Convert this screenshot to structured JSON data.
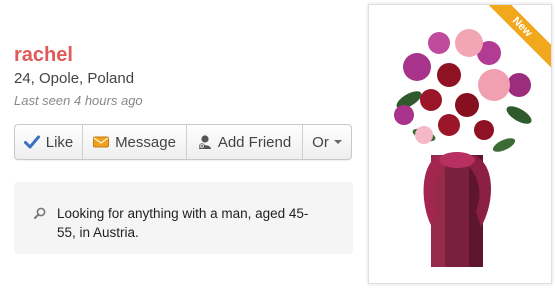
{
  "profile": {
    "name": "rachel",
    "location": "24, Opole, Poland",
    "last_seen": "Last seen 4 hours ago"
  },
  "actions": {
    "like": "Like",
    "message": "Message",
    "add_friend": "Add Friend",
    "or": "Or"
  },
  "looking_for": {
    "text": "Looking for anything with a man, aged 45-55, in Austria."
  },
  "photo": {
    "badge": "New",
    "alt": "Flower bouquet in a vase"
  },
  "colors": {
    "name": "#e05a5a",
    "like_icon": "#3a6fc4",
    "message_icon": "#f0a020",
    "badge": "#f2a81d",
    "vase": "#7a1f3d"
  },
  "icons": {
    "like": "check-icon",
    "message": "envelope-icon",
    "add_friend": "user-add-icon",
    "or": "chevron-down-icon",
    "looking_for": "search-icon"
  }
}
